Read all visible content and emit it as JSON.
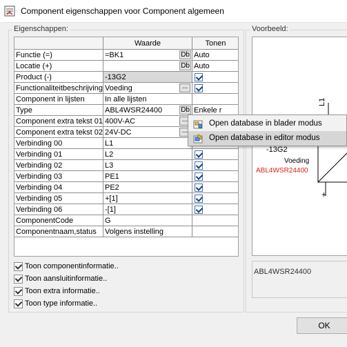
{
  "window": {
    "title": "Component eigenschappen voor Component algemeen"
  },
  "properties": {
    "legend": "Eigenschappen:",
    "columns": [
      "Waarde",
      "Tonen"
    ],
    "rows": [
      {
        "name": "Functie (=)",
        "value": "=BK1",
        "button": "Db",
        "show": "Auto"
      },
      {
        "name": "Locatie (+)",
        "value": "",
        "button": "Db",
        "show": "Auto"
      },
      {
        "name": "Product (-)",
        "value": "-13G2",
        "shaded": true,
        "checked": true
      },
      {
        "name": "Functionaliteitbeschrijving",
        "value": "Voeding",
        "button": "...",
        "checked": true
      },
      {
        "name": "Component in lijsten",
        "value": "In alle lijsten"
      },
      {
        "name": "Type",
        "value": "ABL4WSR24400",
        "button": "Db",
        "show": "Enkele r"
      },
      {
        "name": "Component extra tekst 01",
        "value": "400V-AC",
        "button": "..."
      },
      {
        "name": "Component extra tekst 02",
        "value": "24V-DC",
        "button": "..."
      },
      {
        "name": "Verbinding 00",
        "value": "L1"
      },
      {
        "name": "Verbinding 01",
        "value": "L2",
        "checked": true
      },
      {
        "name": "Verbinding 02",
        "value": "L3",
        "checked": true
      },
      {
        "name": "Verbinding 03",
        "value": "PE1",
        "checked": true
      },
      {
        "name": "Verbinding 04",
        "value": "PE2",
        "checked": true
      },
      {
        "name": "Verbinding 05",
        "value": "+[1]",
        "checked": true
      },
      {
        "name": "Verbinding 06",
        "value": "-[1]",
        "checked": true
      },
      {
        "name": "ComponentCode",
        "value": "G"
      },
      {
        "name": "Componentnaam,status",
        "value": "Volgens instelling"
      }
    ]
  },
  "options": [
    {
      "label": "Toon componentinformatie..",
      "checked": true
    },
    {
      "label": "Toon aansluitinformatie..",
      "checked": true
    },
    {
      "label": "Toon extra informatie..",
      "checked": true
    },
    {
      "label": "Toon type informatie..",
      "checked": true
    }
  ],
  "preview": {
    "legend": "Voorbeeld:",
    "symbol_text": {
      "product": "-13G2",
      "function": "Voeding",
      "type": "ABL4WSR24400",
      "pin_top": "L1",
      "pin_bottom": "+"
    },
    "component_name": "ABL4WSR24400"
  },
  "context_menu": {
    "items": [
      {
        "label": "Open database in blader modus",
        "highlighted": false
      },
      {
        "label": "Open database in editor modus",
        "highlighted": true
      }
    ]
  },
  "buttons": {
    "ok": "OK"
  },
  "colors": {
    "type_text_red": "#e0201f",
    "checkbox_border": "#3b73b9",
    "highlight": "#d6d6d6"
  }
}
